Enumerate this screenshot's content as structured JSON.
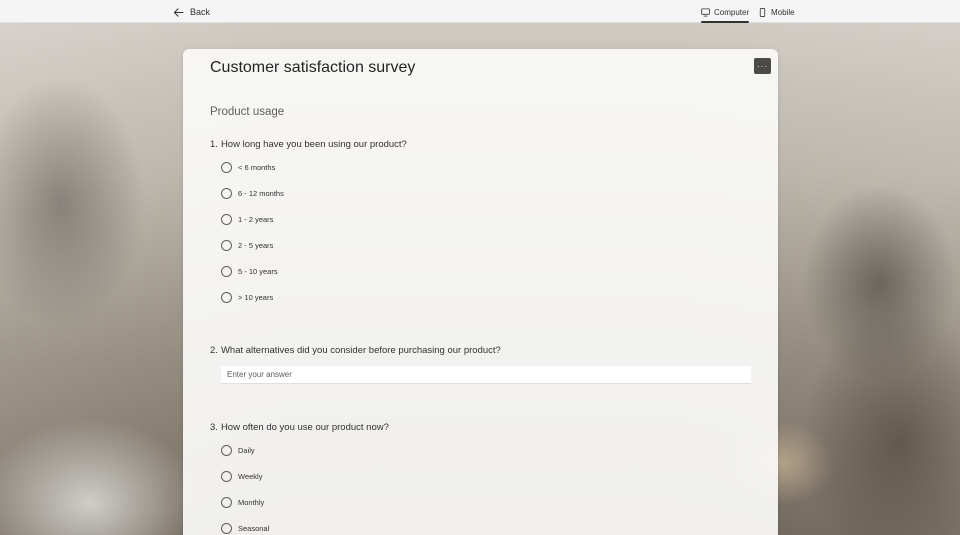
{
  "topbar": {
    "back_label": "Back",
    "tabs": [
      {
        "label": "Computer",
        "icon": "monitor-icon",
        "selected": true
      },
      {
        "label": "Mobile",
        "icon": "phone-icon",
        "selected": false
      }
    ]
  },
  "form": {
    "title": "Customer satisfaction survey",
    "more_label": "···",
    "section_title": "Product usage",
    "questions": [
      {
        "number": "1.",
        "text": "How long have you been using our product?",
        "options": [
          "< 6 months",
          "6 - 12 months",
          "1 - 2 years",
          "2 - 5 years",
          "5 - 10 years",
          "> 10 years"
        ]
      },
      {
        "number": "2.",
        "text": "What alternatives did you consider before purchasing our product?",
        "placeholder": "Enter your answer",
        "value": ""
      },
      {
        "number": "3.",
        "text": "How often do you use our product now?",
        "options": [
          "Daily",
          "Weekly",
          "Monthly",
          "Seasonal"
        ]
      }
    ]
  }
}
